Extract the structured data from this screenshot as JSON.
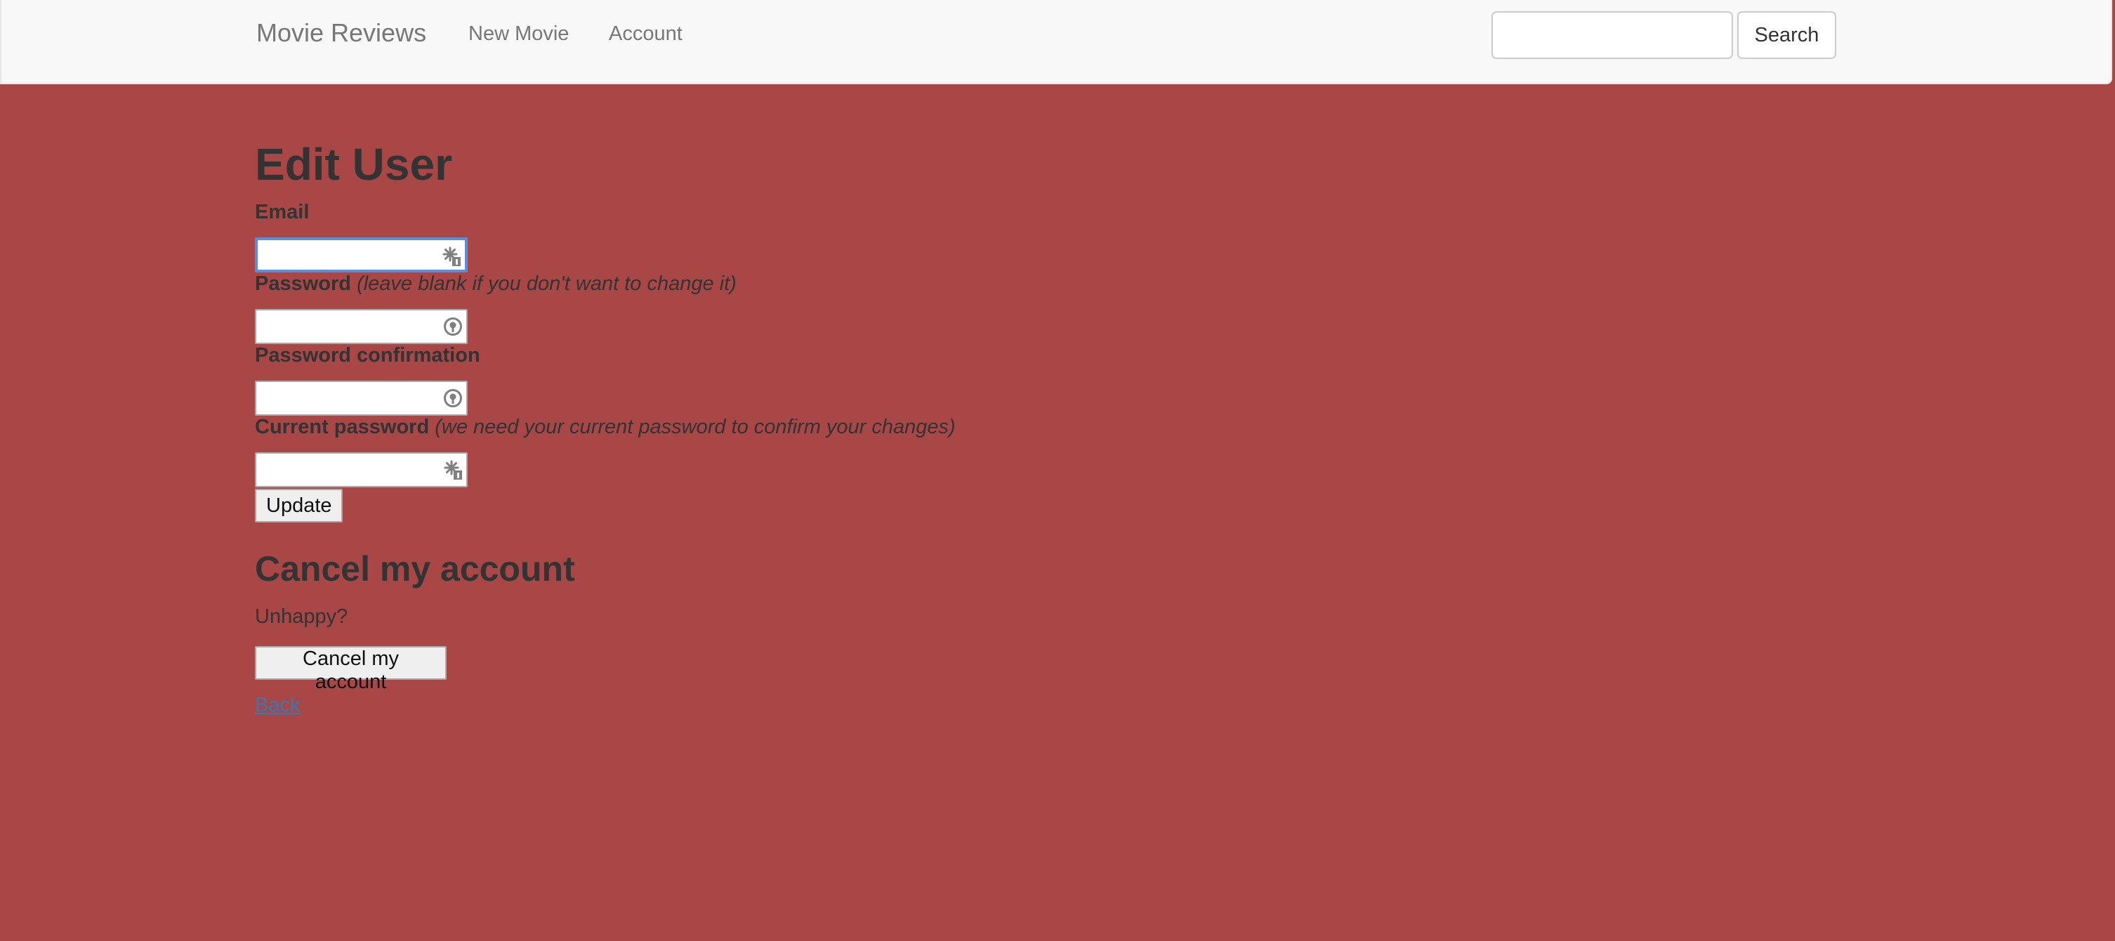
{
  "navbar": {
    "brand": "Movie Reviews",
    "links": [
      "New Movie",
      "Account"
    ],
    "search": {
      "value": "",
      "placeholder": "",
      "button_label": "Search"
    }
  },
  "edit_user": {
    "title": "Edit User",
    "email": {
      "label": "Email",
      "value": ""
    },
    "password": {
      "label": "Password",
      "hint": "(leave blank if you don't want to change it)",
      "value": ""
    },
    "password_confirmation": {
      "label": "Password confirmation",
      "value": ""
    },
    "current_password": {
      "label": "Current password",
      "hint": "(we need your current password to confirm your changes)",
      "value": ""
    },
    "update_button": "Update"
  },
  "cancel_section": {
    "title": "Cancel my account",
    "text": "Unhappy?",
    "button": "Cancel my account"
  },
  "back_link": "Back",
  "colors": {
    "page_background": "#a94646",
    "navbar_background": "#f8f8f8",
    "link": "#337ab7",
    "focus_ring": "#5b8dd9"
  },
  "icons": {
    "autofill": "autofill-key-icon",
    "password_manager": "password-manager-icon"
  }
}
